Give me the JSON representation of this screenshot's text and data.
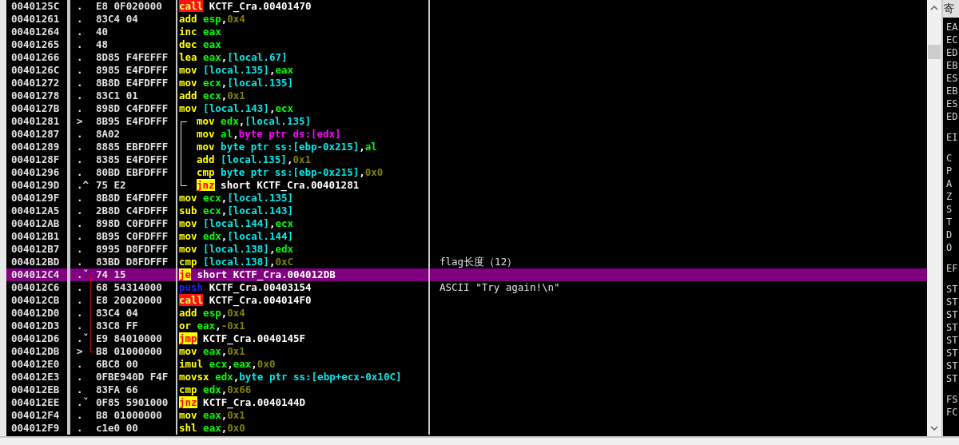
{
  "rows": [
    {
      "address": "0040125C",
      "marker": ".",
      "hex": "E8 0F020000",
      "selected": false,
      "code": [
        {
          "text": "call",
          "kind": "call"
        },
        {
          "text": " KCTF_Cra.00401470",
          "kind": "plain"
        }
      ]
    },
    {
      "address": "00401261",
      "marker": ".",
      "hex": "83C4 04",
      "selected": false,
      "code": [
        {
          "text": "add",
          "kind": "op"
        },
        {
          "text": " esp",
          "kind": "reg"
        },
        {
          "text": ",",
          "kind": "plain"
        },
        {
          "text": "0x4",
          "kind": "num"
        }
      ]
    },
    {
      "address": "00401264",
      "marker": ".",
      "hex": "40",
      "selected": false,
      "code": [
        {
          "text": "inc",
          "kind": "op"
        },
        {
          "text": " eax",
          "kind": "reg"
        }
      ]
    },
    {
      "address": "00401265",
      "marker": ".",
      "hex": "48",
      "selected": false,
      "code": [
        {
          "text": "dec",
          "kind": "op"
        },
        {
          "text": " eax",
          "kind": "reg"
        }
      ]
    },
    {
      "address": "00401266",
      "marker": ".",
      "hex": "8D85 F4FEFFF",
      "selected": false,
      "code": [
        {
          "text": "lea",
          "kind": "op"
        },
        {
          "text": " eax",
          "kind": "reg"
        },
        {
          "text": ",",
          "kind": "plain"
        },
        {
          "text": "[local.67]",
          "kind": "mem"
        }
      ]
    },
    {
      "address": "0040126C",
      "marker": ".",
      "hex": "8985 E4FDFFF",
      "selected": false,
      "code": [
        {
          "text": "mov ",
          "kind": "op"
        },
        {
          "text": "[local.135]",
          "kind": "mem"
        },
        {
          "text": ",",
          "kind": "plain"
        },
        {
          "text": "eax",
          "kind": "reg"
        }
      ]
    },
    {
      "address": "00401272",
      "marker": ".",
      "hex": "8B8D E4FDFFF",
      "selected": false,
      "code": [
        {
          "text": "mov",
          "kind": "op"
        },
        {
          "text": " ecx",
          "kind": "reg"
        },
        {
          "text": ",",
          "kind": "plain"
        },
        {
          "text": "[local.135]",
          "kind": "mem"
        }
      ]
    },
    {
      "address": "00401278",
      "marker": ".",
      "hex": "83C1 01",
      "selected": false,
      "code": [
        {
          "text": "add",
          "kind": "op"
        },
        {
          "text": " ecx",
          "kind": "reg"
        },
        {
          "text": ",",
          "kind": "plain"
        },
        {
          "text": "0x1",
          "kind": "num"
        }
      ]
    },
    {
      "address": "0040127B",
      "marker": ".",
      "hex": "898D C4FDFFF",
      "selected": false,
      "code": [
        {
          "text": "mov ",
          "kind": "op"
        },
        {
          "text": "[local.143]",
          "kind": "mem"
        },
        {
          "text": ",",
          "kind": "plain"
        },
        {
          "text": "ecx",
          "kind": "reg"
        }
      ]
    },
    {
      "address": "00401281",
      "marker": ">",
      "hex": "8B95 E4FDFFF",
      "selected": false,
      "loop": true,
      "code": [
        {
          "text": "mov",
          "kind": "op"
        },
        {
          "text": " edx",
          "kind": "reg"
        },
        {
          "text": ",",
          "kind": "plain"
        },
        {
          "text": "[local.135]",
          "kind": "mem"
        }
      ]
    },
    {
      "address": "00401287",
      "marker": ".",
      "hex": "8A02",
      "selected": false,
      "loop": true,
      "code": [
        {
          "text": "mov",
          "kind": "op"
        },
        {
          "text": " al",
          "kind": "reg"
        },
        {
          "text": ",",
          "kind": "plain"
        },
        {
          "text": "byte ptr ds:[edx]",
          "kind": "ptr"
        }
      ]
    },
    {
      "address": "00401289",
      "marker": ".",
      "hex": "8885 EBFDFFF",
      "selected": false,
      "loop": true,
      "code": [
        {
          "text": "mov ",
          "kind": "op"
        },
        {
          "text": "byte ptr ss:[ebp-0x215]",
          "kind": "mem"
        },
        {
          "text": ",",
          "kind": "plain"
        },
        {
          "text": "al",
          "kind": "reg"
        }
      ]
    },
    {
      "address": "0040128F",
      "marker": ".",
      "hex": "8385 E4FDFFF",
      "selected": false,
      "loop": true,
      "code": [
        {
          "text": "add ",
          "kind": "op"
        },
        {
          "text": "[local.135]",
          "kind": "mem"
        },
        {
          "text": ",",
          "kind": "plain"
        },
        {
          "text": "0x1",
          "kind": "num"
        }
      ]
    },
    {
      "address": "00401296",
      "marker": ".",
      "hex": "80BD EBFDFFF",
      "selected": false,
      "loop": true,
      "code": [
        {
          "text": "cmp ",
          "kind": "op"
        },
        {
          "text": "byte ptr ss:[ebp-0x215]",
          "kind": "mem"
        },
        {
          "text": ",",
          "kind": "plain"
        },
        {
          "text": "0x0",
          "kind": "num"
        }
      ]
    },
    {
      "address": "0040129D",
      "marker": ".^",
      "hex": "75 E2",
      "selected": false,
      "loop": true,
      "code": [
        {
          "text": "jnz",
          "kind": "jump"
        },
        {
          "text": " short KCTF_Cra.00401281",
          "kind": "plain"
        }
      ]
    },
    {
      "address": "0040129F",
      "marker": ".",
      "hex": "8B8D E4FDFFF",
      "selected": false,
      "code": [
        {
          "text": "mov",
          "kind": "op"
        },
        {
          "text": " ecx",
          "kind": "reg"
        },
        {
          "text": ",",
          "kind": "plain"
        },
        {
          "text": "[local.135]",
          "kind": "mem"
        }
      ]
    },
    {
      "address": "004012A5",
      "marker": ".",
      "hex": "2B8D C4FDFFF",
      "selected": false,
      "code": [
        {
          "text": "sub",
          "kind": "op"
        },
        {
          "text": " ecx",
          "kind": "reg"
        },
        {
          "text": ",",
          "kind": "plain"
        },
        {
          "text": "[local.143]",
          "kind": "mem"
        }
      ]
    },
    {
      "address": "004012AB",
      "marker": ".",
      "hex": "898D C0FDFFF",
      "selected": false,
      "code": [
        {
          "text": "mov ",
          "kind": "op"
        },
        {
          "text": "[local.144]",
          "kind": "mem"
        },
        {
          "text": ",",
          "kind": "plain"
        },
        {
          "text": "ecx",
          "kind": "reg"
        }
      ]
    },
    {
      "address": "004012B1",
      "marker": ".",
      "hex": "8B95 C0FDFFF",
      "selected": false,
      "code": [
        {
          "text": "mov",
          "kind": "op"
        },
        {
          "text": " edx",
          "kind": "reg"
        },
        {
          "text": ",",
          "kind": "plain"
        },
        {
          "text": "[local.144]",
          "kind": "mem"
        }
      ]
    },
    {
      "address": "004012B7",
      "marker": ".",
      "hex": "8995 D8FDFFF",
      "selected": false,
      "code": [
        {
          "text": "mov ",
          "kind": "op"
        },
        {
          "text": "[local.138]",
          "kind": "mem"
        },
        {
          "text": ",",
          "kind": "plain"
        },
        {
          "text": "edx",
          "kind": "reg"
        }
      ]
    },
    {
      "address": "004012BD",
      "marker": ".",
      "hex": "83BD D8FDFFF",
      "selected": false,
      "comment": "flag长度（12）",
      "code": [
        {
          "text": "cmp ",
          "kind": "op"
        },
        {
          "text": "[local.138]",
          "kind": "mem"
        },
        {
          "text": ",",
          "kind": "plain"
        },
        {
          "text": "0xC",
          "kind": "num"
        }
      ]
    },
    {
      "address": "004012C4",
      "marker": ".ˇ",
      "hex": "74 15",
      "selected": true,
      "jump": true,
      "code": [
        {
          "text": "je",
          "kind": "jump"
        },
        {
          "text": " short KCTF_Cra.004012DB",
          "kind": "plain"
        }
      ]
    },
    {
      "address": "004012C6",
      "marker": ".",
      "hex": "68 54314000",
      "selected": false,
      "jump": true,
      "comment": "ASCII \"Try again!\\n\"",
      "code": [
        {
          "text": "push",
          "kind": "push"
        },
        {
          "text": " KCTF_Cra.00403154",
          "kind": "plain"
        }
      ]
    },
    {
      "address": "004012CB",
      "marker": ".",
      "hex": "E8 20020000",
      "selected": false,
      "jump": true,
      "code": [
        {
          "text": "call",
          "kind": "call"
        },
        {
          "text": " KCTF_Cra.004014F0",
          "kind": "plain"
        }
      ]
    },
    {
      "address": "004012D0",
      "marker": ".",
      "hex": "83C4 04",
      "selected": false,
      "jump": true,
      "code": [
        {
          "text": "add",
          "kind": "op"
        },
        {
          "text": " esp",
          "kind": "reg"
        },
        {
          "text": ",",
          "kind": "plain"
        },
        {
          "text": "0x4",
          "kind": "num"
        }
      ]
    },
    {
      "address": "004012D3",
      "marker": ".",
      "hex": "83C8 FF",
      "selected": false,
      "jump": true,
      "code": [
        {
          "text": "or",
          "kind": "op"
        },
        {
          "text": " eax",
          "kind": "reg"
        },
        {
          "text": ",",
          "kind": "plain"
        },
        {
          "text": "-0x1",
          "kind": "num"
        }
      ]
    },
    {
      "address": "004012D6",
      "marker": ".ˇ",
      "hex": "E9 84010000",
      "selected": false,
      "jump": true,
      "code": [
        {
          "text": "jmp",
          "kind": "jump"
        },
        {
          "text": " KCTF_Cra.0040145F",
          "kind": "plain"
        }
      ]
    },
    {
      "address": "004012DB",
      "marker": ">",
      "hex": "B8 01000000",
      "selected": false,
      "jump": true,
      "code": [
        {
          "text": "mov",
          "kind": "op"
        },
        {
          "text": " eax",
          "kind": "reg"
        },
        {
          "text": ",",
          "kind": "plain"
        },
        {
          "text": "0x1",
          "kind": "num"
        }
      ]
    },
    {
      "address": "004012E0",
      "marker": ".",
      "hex": "6BC8 00",
      "selected": false,
      "code": [
        {
          "text": "imul",
          "kind": "op"
        },
        {
          "text": " ecx",
          "kind": "reg"
        },
        {
          "text": ",",
          "kind": "plain"
        },
        {
          "text": "eax",
          "kind": "reg"
        },
        {
          "text": ",",
          "kind": "plain"
        },
        {
          "text": "0x0",
          "kind": "num"
        }
      ]
    },
    {
      "address": "004012E3",
      "marker": ".",
      "hex": "0FBE940D F4F",
      "selected": false,
      "code": [
        {
          "text": "movsx",
          "kind": "op"
        },
        {
          "text": " edx",
          "kind": "reg"
        },
        {
          "text": ",",
          "kind": "plain"
        },
        {
          "text": "byte ptr ss:[ebp+ecx-0x10C]",
          "kind": "mem"
        }
      ]
    },
    {
      "address": "004012EB",
      "marker": ".",
      "hex": "83FA 66",
      "selected": false,
      "code": [
        {
          "text": "cmp",
          "kind": "op"
        },
        {
          "text": " edx",
          "kind": "reg"
        },
        {
          "text": ",",
          "kind": "plain"
        },
        {
          "text": "0x66",
          "kind": "num"
        }
      ]
    },
    {
      "address": "004012EE",
      "marker": ".ˇ",
      "hex": "0F85 5901000",
      "selected": false,
      "code": [
        {
          "text": "jnz",
          "kind": "jump"
        },
        {
          "text": " KCTF_Cra.0040144D",
          "kind": "plain"
        }
      ]
    },
    {
      "address": "004012F4",
      "marker": ".",
      "hex": "B8 01000000",
      "selected": false,
      "code": [
        {
          "text": "mov",
          "kind": "op"
        },
        {
          "text": " eax",
          "kind": "reg"
        },
        {
          "text": ",",
          "kind": "plain"
        },
        {
          "text": "0x1",
          "kind": "num"
        }
      ]
    },
    {
      "address": "004012F9",
      "marker": ".",
      "hex": "c1e0 00",
      "selected": false,
      "code": [
        {
          "text": "shl",
          "kind": "op"
        },
        {
          "text": " eax",
          "kind": "reg"
        },
        {
          "text": ",",
          "kind": "plain"
        },
        {
          "text": "0x0",
          "kind": "num"
        }
      ]
    }
  ],
  "register_panel": {
    "header": "寄",
    "groups": [
      [
        "EA",
        "EC",
        "ED",
        "EB",
        "ES",
        "EB",
        "ES",
        "ED"
      ],
      [
        "EI"
      ],
      [
        "C",
        "P",
        "A",
        "Z",
        "S",
        "T",
        "D",
        "O"
      ],
      [
        "EF"
      ],
      [
        "ST",
        "ST",
        "ST",
        "ST",
        "ST",
        "ST",
        "ST",
        "ST"
      ],
      [
        "FS",
        "FC"
      ]
    ]
  }
}
